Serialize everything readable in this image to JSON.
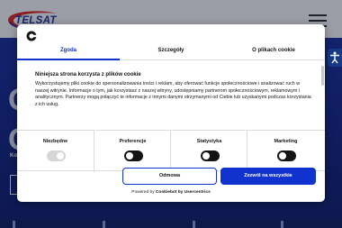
{
  "site": {
    "logo_text": "TELSAT",
    "hero_letters": [
      "O",
      "O"
    ],
    "hero_sub": "Kon"
  },
  "colors": {
    "brand_blue": "#1032cf",
    "hero_blue": "#132a9c",
    "logo_red": "#e2231a",
    "logo_blue": "#1b2f9a"
  },
  "cookie": {
    "tabs": [
      "Zgoda",
      "Szczegóły",
      "O plikach cookie"
    ],
    "active_tab": "Zgoda",
    "title": "Niniejsza strona korzysta z plików cookie",
    "text": "Wykorzystujemy pliki cookie do spersonalizowania treści i reklam, aby oferować funkcje społecznościowe i analizować ruch w naszej witrynie. Informacje o tym, jak korzystasz z naszej witryny, udostępniamy partnerom społecznościowym, reklamowym i analitycznym. Partnerzy mogą połączyć te informacje z innymi danymi otrzymanymi od Ciebie lub uzyskanymi podczas korzystania z ich usług.",
    "categories": [
      {
        "label": "Niezbędne",
        "enabled": true,
        "locked": true
      },
      {
        "label": "Preferencje",
        "enabled": false,
        "locked": false
      },
      {
        "label": "Statystyka",
        "enabled": false,
        "locked": false
      },
      {
        "label": "Marketing",
        "enabled": false,
        "locked": false
      }
    ],
    "deny_label": "Odmowa",
    "allow_label": "Zezwól na wszystkie",
    "powered_prefix": "Powered by",
    "powered_brand": "Cookiebot by Usercentrics"
  }
}
